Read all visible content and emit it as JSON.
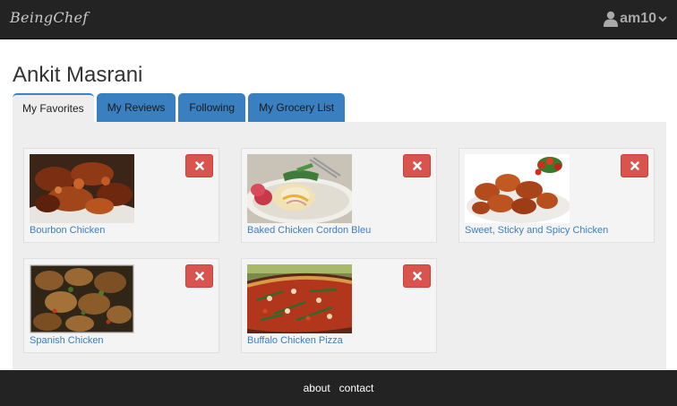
{
  "navbar": {
    "brand": "BeingChef",
    "username": "am10"
  },
  "profile": {
    "name": "Ankit Masrani"
  },
  "tabs": [
    {
      "label": "My Favorites",
      "active": true
    },
    {
      "label": "My Reviews",
      "active": false
    },
    {
      "label": "Following",
      "active": false
    },
    {
      "label": "My Grocery List",
      "active": false
    }
  ],
  "favorites": [
    {
      "title": "Bourbon Chicken"
    },
    {
      "title": "Baked Chicken Cordon Bleu"
    },
    {
      "title": "Sweet, Sticky and Spicy Chicken"
    },
    {
      "title": "Spanish Chicken"
    },
    {
      "title": "Buffalo Chicken Pizza"
    }
  ],
  "footer": {
    "about": "about",
    "contact": "contact"
  },
  "colors": {
    "navbar": "#232323",
    "tab_active": "#eeeeee",
    "tab_inactive": "#3a7fc0",
    "delete_button": "#d9534f",
    "link": "#3a7fc0"
  }
}
